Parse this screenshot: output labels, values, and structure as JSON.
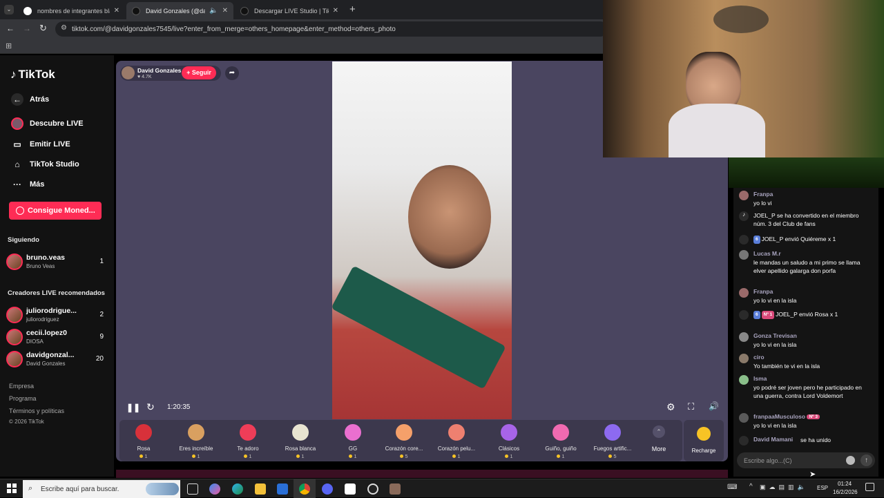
{
  "browser": {
    "tabs": [
      {
        "title": "nombres de integrantes black p",
        "active": false
      },
      {
        "title": "David Gonzales (@davidgo",
        "active": true
      },
      {
        "title": "Descargar LIVE Studio | TikTok",
        "active": false
      }
    ],
    "new_tab": "+",
    "url": "tiktok.com/@davidgonzales7545/live?enter_from_merge=others_homepage&enter_method=others_photo"
  },
  "sidebar": {
    "logo": "TikTok",
    "back": "Atrás",
    "nav": [
      "Descubre LIVE",
      "Emitir LIVE",
      "TikTok Studio",
      "Más"
    ],
    "coins_button": "Consigue Moned...",
    "following_title": "Siguiendo",
    "following": [
      {
        "name": "bruno.veas",
        "sub": "Bruno Veas",
        "count": "1"
      }
    ],
    "recommended_title": "Creadores LIVE recomendados",
    "recommended": [
      {
        "name": "juliorodrigue...",
        "sub": "juliorodriguez",
        "count": "2"
      },
      {
        "name": "cecii.lopez0",
        "sub": "DIOSA",
        "count": "9"
      },
      {
        "name": "davidgonzal...",
        "sub": "David Gonzales",
        "count": "20"
      }
    ],
    "footer": [
      "Empresa",
      "Programa",
      "Términos y políticas",
      "© 2026 TikTok"
    ]
  },
  "live": {
    "host_name": "David Gonzales",
    "likes": "♥ 4.7K",
    "follow_button": "+ Seguir",
    "time": "1:20:35"
  },
  "gifts": [
    {
      "name": "Rosa",
      "price": "1",
      "color": "#d8313a"
    },
    {
      "name": "Eres increíble",
      "price": "1",
      "color": "#d9a060"
    },
    {
      "name": "Te adoro",
      "price": "1",
      "color": "#ee3d58"
    },
    {
      "name": "Rosa blanca",
      "price": "1",
      "color": "#e8e4d0"
    },
    {
      "name": "GG",
      "price": "1",
      "color": "#ea6fcf"
    },
    {
      "name": "Corazón core...",
      "price": "5",
      "color": "#f5a06a"
    },
    {
      "name": "Corazón pelu...",
      "price": "1",
      "color": "#ee8070"
    },
    {
      "name": "Clásicos",
      "price": "1",
      "color": "#a764e8"
    },
    {
      "name": "Guiño, guiño",
      "price": "1",
      "color": "#f06ab0"
    },
    {
      "name": "Fuegos artific...",
      "price": "5",
      "color": "#8d6af0"
    }
  ],
  "gift_more": "More",
  "recharge": "Recharge",
  "chat": {
    "messages": [
      {
        "user": "Franpa",
        "text": "yo lo vi"
      },
      {
        "user": "",
        "text": "JOEL_P se ha convertido en el miembro núm. 3 del Club de fans"
      },
      {
        "user": "",
        "text": "JOEL_P envió Quiéreme x 1",
        "badge": "6"
      },
      {
        "user": "Lucas M.r",
        "text": "le mandas un saludo a mi primo se llama elver apellido galarga don porfa"
      },
      {
        "user": "Franpa",
        "text": "yo lo vi en la isla"
      },
      {
        "user": "",
        "text": "JOEL_P envió Rosa x 1",
        "badge": "6",
        "badge2": "Nº 1"
      },
      {
        "user": "Gonza Trevisan",
        "text": "yo lo vi en la isla"
      },
      {
        "user": "ciro",
        "text": "Yo también te vi en la isla"
      },
      {
        "user": "Isma",
        "text": "yo podré ser joven pero he participado en una guerra, contra Lord Voldemort"
      },
      {
        "user": "franpaaMusculoso",
        "text": "yo lo vi en la isla",
        "badge2": "Nº 3"
      },
      {
        "user": "David Mamani",
        "text": "se ha unido"
      }
    ],
    "input_placeholder": "Escribe algo...(C)"
  },
  "taskbar": {
    "search": "Escribe aquí para buscar.",
    "lang": "ESP",
    "time": "01:24",
    "date": "16/2/2026"
  }
}
